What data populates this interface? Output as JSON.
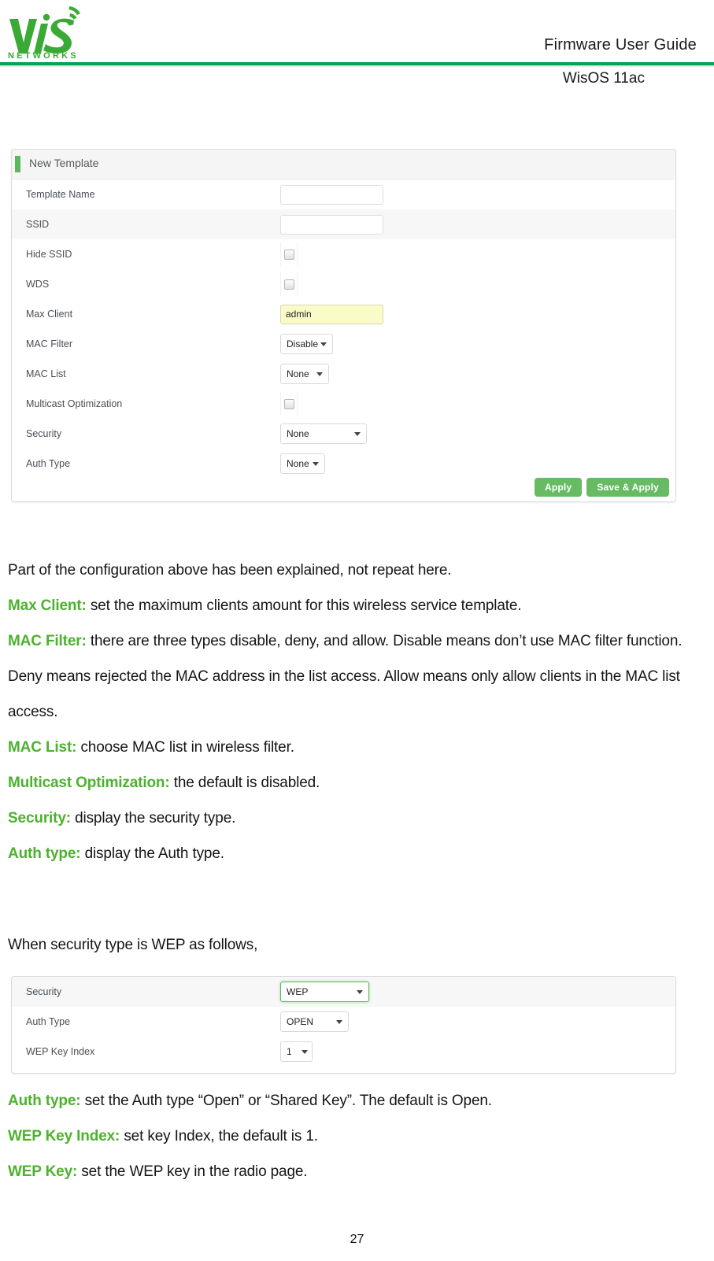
{
  "header": {
    "title": "Firmware User Guide",
    "subtitle": "WisOS 11ac",
    "logo_wordmark": "WIS",
    "logo_subtext": "N E T W O R K S",
    "rule_color": "#00a651"
  },
  "new_template_panel": {
    "heading": "New Template",
    "accent_color": "#5cb85c",
    "rows": [
      {
        "label": "Template Name",
        "control": "text",
        "value": "",
        "placeholder": ""
      },
      {
        "label": "SSID",
        "control": "text",
        "value": "",
        "placeholder": ""
      },
      {
        "label": "Hide SSID",
        "control": "checkbox",
        "checked": false
      },
      {
        "label": "WDS",
        "control": "checkbox",
        "checked": false
      },
      {
        "label": "Max Client",
        "control": "text",
        "value": "admin",
        "autofill": true
      },
      {
        "label": "MAC Filter",
        "control": "select",
        "value": "Disable"
      },
      {
        "label": "MAC List",
        "control": "select",
        "value": "None"
      },
      {
        "label": "Multicast Optimization",
        "control": "checkbox",
        "checked": false
      },
      {
        "label": "Security",
        "control": "select",
        "value": "None"
      },
      {
        "label": "Auth Type",
        "control": "select",
        "value": "None"
      }
    ],
    "buttons": {
      "apply": "Apply",
      "save_apply": "Save & Apply"
    },
    "button_color": "#66bb63"
  },
  "wep_panel": {
    "rows": [
      {
        "label": "Security",
        "control": "select",
        "value": "WEP",
        "focused": true
      },
      {
        "label": "Auth Type",
        "control": "select",
        "value": "OPEN"
      },
      {
        "label": "WEP Key Index",
        "control": "select",
        "value": "1"
      }
    ]
  },
  "prose": {
    "intro": "Part of the configuration above has been explained, not repeat here.",
    "items": [
      {
        "term": "Max Client:",
        "text": " set the maximum clients amount for this wireless service template."
      },
      {
        "term": "MAC Filter:",
        "text": " there are three types disable, deny, and allow. Disable means don’t use MAC filter function. Deny means rejected the MAC address in the list access. Allow means only allow clients in the MAC list access."
      },
      {
        "term": "MAC List:",
        "text": " choose MAC list in wireless filter."
      },
      {
        "term": "Multicast Optimization:",
        "text": " the default is disabled."
      },
      {
        "term": "Security:",
        "text": " display the security type."
      },
      {
        "term": "Auth type:",
        "text": " display the Auth type."
      }
    ],
    "wep_intro": "When security type is WEP as follows,",
    "wep_items": [
      {
        "term": "Auth type:",
        "text": " set the Auth type “Open” or “Shared Key”. The default is Open."
      },
      {
        "term": "WEP Key Index:",
        "text": " set key Index, the default is 1."
      },
      {
        "term": "WEP Key:",
        "text": " set the WEP key in the radio page."
      }
    ],
    "highlight_color": "#4cb22e"
  },
  "page_number": "27"
}
